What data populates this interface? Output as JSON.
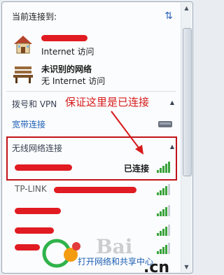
{
  "header": {
    "title": "当前连接到:",
    "refresh_icon": "refresh-icon"
  },
  "connections": [
    {
      "name_redacted": true,
      "status": "Internet 访问",
      "icon": "house-icon"
    },
    {
      "name": "未识别的网络",
      "status": "无 Internet 访问",
      "icon": "bench-icon"
    }
  ],
  "dialup": {
    "heading": "拨号和 VPN",
    "item": "宽带连接"
  },
  "annotation": "保证这里是已连接",
  "wireless": {
    "heading": "无线网络连接",
    "networks": [
      {
        "name": "",
        "status": "已连接",
        "signal": 5,
        "connected": true
      },
      {
        "name": "TP-LINK",
        "status": "",
        "signal": 4
      },
      {
        "name": "",
        "status": "",
        "signal": 4
      },
      {
        "name": "",
        "status": "",
        "signal": 4
      },
      {
        "name": "",
        "status": "",
        "signal": 4
      }
    ]
  },
  "footer": {
    "link": "打开网络和共享中心"
  },
  "watermark": {
    "text": "Bai",
    "domain": ".cn"
  },
  "colors": {
    "highlight": "#c21419",
    "link": "#1d5fb4",
    "signal": "#3aa33a"
  }
}
